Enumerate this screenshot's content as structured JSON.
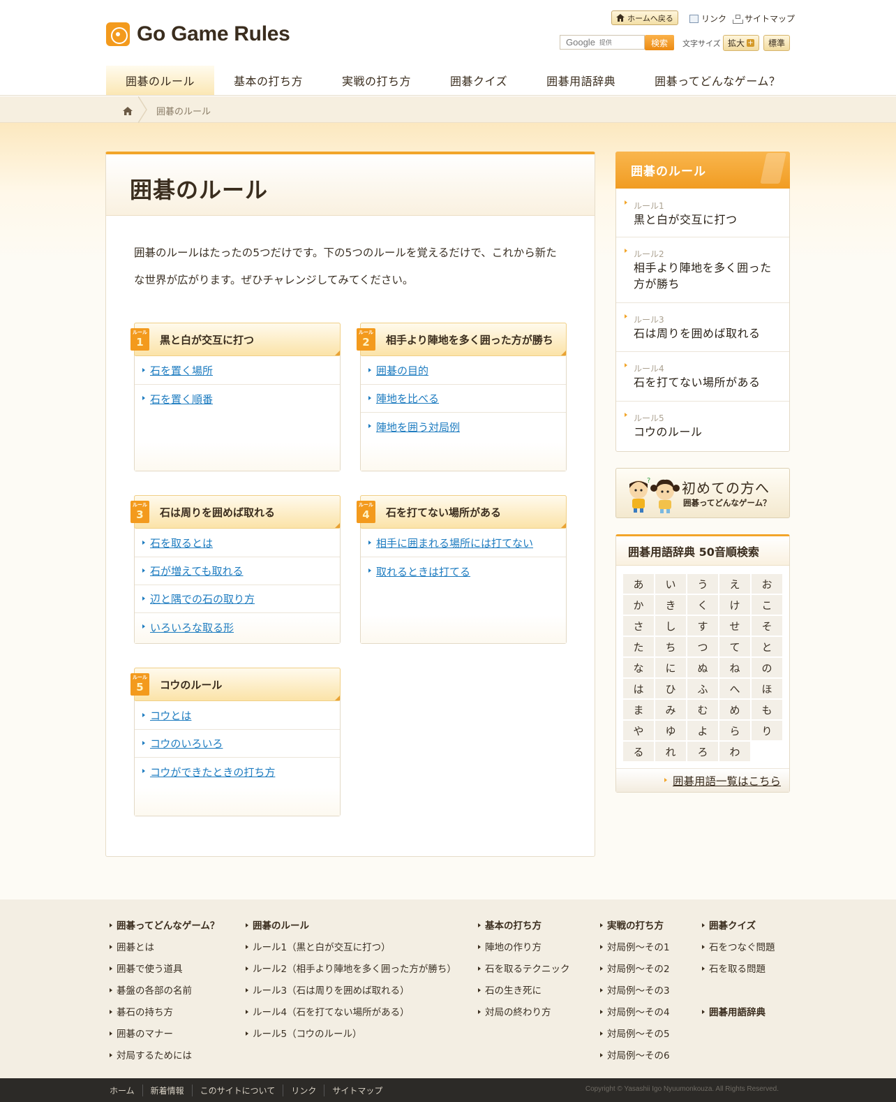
{
  "site": {
    "name": "Go Game Rules"
  },
  "utility": {
    "home_button": "ホームへ戻る",
    "links": "リンク",
    "sitemap": "サイトマップ",
    "search_provider": "Google",
    "search_provided": "提供",
    "search_button": "検索",
    "font_size_label": "文字サイズ",
    "enlarge": "拡大",
    "standard": "標準"
  },
  "nav": {
    "items": [
      "囲碁のルール",
      "基本の打ち方",
      "実戦の打ち方",
      "囲碁クイズ",
      "囲碁用語辞典",
      "囲碁ってどんなゲーム？"
    ],
    "active": 0
  },
  "breadcrumb": {
    "current": "囲碁のルール"
  },
  "main": {
    "title": "囲碁のルール",
    "intro": "囲碁のルールはたったの5つだけです。下の5つのルールを覚えるだけで、これから新たな世界が広がります。ぜひチャレンジしてみてください。",
    "badge_label": "ルール",
    "rules": [
      {
        "num": "1",
        "title": "黒と白が交互に打つ",
        "links": [
          "石を置く場所",
          "石を置く順番"
        ]
      },
      {
        "num": "2",
        "title": "相手より陣地を多く囲った方が勝ち",
        "links": [
          "囲碁の目的",
          "陣地を比べる",
          "陣地を囲う対局例"
        ]
      },
      {
        "num": "3",
        "title": "石は周りを囲めば取れる",
        "links": [
          "石を取るとは",
          "石が増えても取れる",
          "辺と隅での石の取り方",
          "いろいろな取る形"
        ]
      },
      {
        "num": "4",
        "title": "石を打てない場所がある",
        "links": [
          "相手に囲まれる場所には打てない",
          "取れるときは打てる"
        ]
      },
      {
        "num": "5",
        "title": "コウのルール",
        "links": [
          "コウとは",
          "コウのいろいろ",
          "コウができたときの打ち方"
        ]
      }
    ]
  },
  "sidebar": {
    "rules_title": "囲碁のルール",
    "rules": [
      {
        "num": "ルール1",
        "label": "黒と白が交互に打つ"
      },
      {
        "num": "ルール2",
        "label": "相手より陣地を多く囲った方が勝ち"
      },
      {
        "num": "ルール3",
        "label": "石は周りを囲めば取れる"
      },
      {
        "num": "ルール4",
        "label": "石を打てない場所がある"
      },
      {
        "num": "ルール5",
        "label": "コウのルール"
      }
    ],
    "beginner_title": "初めての方へ",
    "beginner_sub": "囲碁ってどんなゲーム？",
    "dict_title": "囲碁用語辞典 50音順検索",
    "kana": [
      "あ",
      "い",
      "う",
      "え",
      "お",
      "か",
      "き",
      "く",
      "け",
      "こ",
      "さ",
      "し",
      "す",
      "せ",
      "そ",
      "た",
      "ち",
      "つ",
      "て",
      "と",
      "な",
      "に",
      "ぬ",
      "ね",
      "の",
      "は",
      "ひ",
      "ふ",
      "へ",
      "ほ",
      "ま",
      "み",
      "む",
      "め",
      "も",
      "や",
      "ゆ",
      "よ",
      "ら",
      "り",
      "る",
      "れ",
      "ろ",
      "わ"
    ],
    "dict_link": "囲碁用語一覧はこちら"
  },
  "footer": {
    "columns": [
      {
        "heading": "囲碁ってどんなゲーム？",
        "items": [
          "囲碁とは",
          "囲碁で使う道具",
          "碁盤の各部の名前",
          "碁石の持ち方",
          "囲碁のマナー",
          "対局するためには"
        ]
      },
      {
        "heading": "囲碁のルール",
        "items": [
          "ルール1（黒と白が交互に打つ）",
          "ルール2（相手より陣地を多く囲った方が勝ち）",
          "ルール3（石は周りを囲めば取れる）",
          "ルール4（石を打てない場所がある）",
          "ルール5（コウのルール）"
        ]
      },
      {
        "heading": "基本の打ち方",
        "items": [
          "陣地の作り方",
          "石を取るテクニック",
          "石の生き死に",
          "対局の終わり方"
        ]
      },
      {
        "heading": "実戦の打ち方",
        "items": [
          "対局例～その1",
          "対局例～その2",
          "対局例～その3",
          "対局例～その4",
          "対局例～その5",
          "対局例～その6"
        ]
      },
      {
        "heading": "囲碁クイズ",
        "items": [
          "石をつなぐ問題",
          "石を取る問題"
        ]
      }
    ],
    "extra_heading": "囲碁用語辞典",
    "bottom_links": [
      "ホーム",
      "新着情報",
      "このサイトについて",
      "リンク",
      "サイトマップ"
    ],
    "copyright": "Copyright © Yasashii Igo Nyuumonkouza. All Rights Reserved."
  },
  "colors": {
    "accent": "#f39a1d",
    "link": "#1e7cc0",
    "footer_bg": "#f3eee3",
    "bottom_bar": "#2c2a27"
  }
}
